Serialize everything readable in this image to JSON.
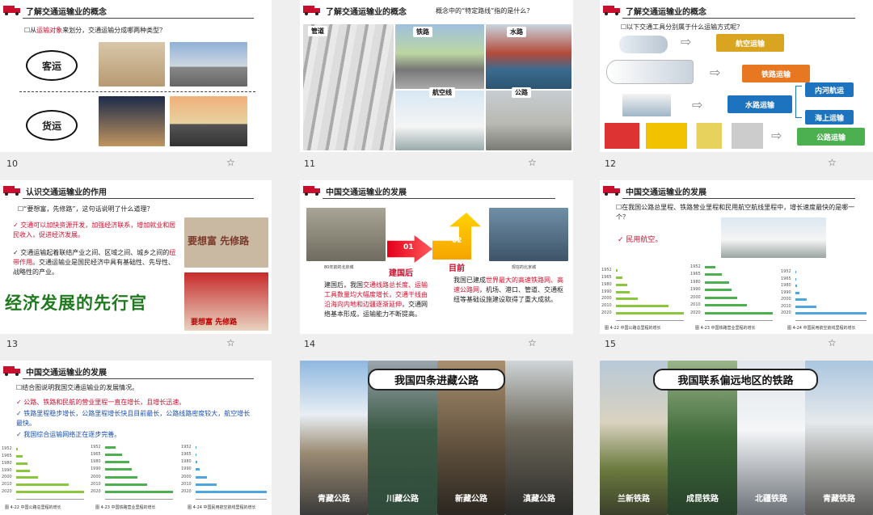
{
  "slides": [
    {
      "num": "10",
      "title": "了解交通运输业的概念",
      "question": "从运输对象来划分，交通运输分成哪两种类型？",
      "keyword": "运输对象",
      "passenger": "客运",
      "freight": "货运"
    },
    {
      "num": "11",
      "title": "了解交通运输业的概念",
      "note": "概念中的“特定路线”指的是什么？",
      "pipeline": "管道",
      "railway": "铁路",
      "waterway": "水路",
      "airline": "航空线",
      "highway": "公路"
    },
    {
      "num": "12",
      "title": "了解交通运输业的概念",
      "question": "以下交通工具分别属于什么运输方式呢？",
      "air": "航空运输",
      "rail": "铁路运输",
      "water": "水路运输",
      "inland": "内河航运",
      "sea": "海上运输",
      "road": "公路运输"
    },
    {
      "num": "13",
      "title": "认识交通运输业的作用",
      "question": "“要想富，先修路”，这句话说明了什么道理？",
      "point1": "交通可以加快资源开发，加强经济联系，增加就业和居民收入，促进经济发展。",
      "point2a": "交通运输起着联结产业之间、区域之间、城乡之间的",
      "point2b": "纽带作用",
      "point2c": "。交通运输业是国民经济中具有基础性、先导性、战略性的产业。",
      "sign_text": "要想富 先修路",
      "poster_text": "要想富 先修路",
      "slogan": "经济发展的先行官"
    },
    {
      "num": "14",
      "title": "中国交通运输业的发展",
      "photo1_caption": "80年前的北京城",
      "photo2_caption": "现在的北京城",
      "step1": "01",
      "step2": "02",
      "label1": "建国后",
      "label2": "目前",
      "para1a": "建国后，我国",
      "para1b": "交通线路总长度、运输工具数量均大幅度增长，交通干线由沿海向内地和边疆逐渐延伸",
      "para1c": "，交通网络基本形成，运输能力不断提高。",
      "para2a": "我国已建成",
      "para2b": "世界最大的高速铁路网、高速公路网",
      "para2c": "，机场、港口、管道、交通枢纽等基础设施建设取得了重大成就。"
    },
    {
      "num": "15",
      "title": "中国交通运输业的发展",
      "question": "在我国公路总里程、铁路营业里程和民用航空航线里程中，增长速度最快的是哪一个？",
      "answer": "✓ 民用航空。",
      "cap1": "图 4-22  中国公路总里程的增长",
      "cap2": "图 4-23  中国铁路营业里程的增长",
      "cap3": "图 4-24  中国民用航空航线里程的增长"
    },
    {
      "num": "",
      "title": "中国交通运输业的发展",
      "question": "结合图说明我国交通运输业的发展情况。",
      "p1": "公路、铁路和民航的营业里程一直在增长，且增长迅速。",
      "p2": "铁路里程稳步增长，公路里程增长快且目前最长，公路线路密度较大，航空增长最快。",
      "p3": "我国综合运输网络正在逐步完善。",
      "cap1": "图 4-22  中国公路总里程的增长",
      "cap2": "图 4-23  中国铁路营业里程的增长",
      "cap3": "图 4-24  中国民用航空航线里程的增长"
    },
    {
      "banner": "我国四条进藏公路",
      "roads": [
        "青藏公路",
        "川藏公路",
        "新藏公路",
        "滇藏公路"
      ]
    },
    {
      "banner": "我国联系偏远地区的铁路",
      "rails": [
        "兰新铁路",
        "成昆铁路",
        "北疆铁路",
        "青藏铁路"
      ]
    }
  ],
  "chart_axis": {
    "years": [
      "1952",
      "1965",
      "1980",
      "1990",
      "2000",
      "2010",
      "2020"
    ]
  },
  "chart_data": [
    {
      "type": "bar",
      "title": "图 4-22  中国公路总里程的增长",
      "categories": [
        "1952",
        "1965",
        "1980",
        "1990",
        "2000",
        "2010",
        "2020"
      ],
      "values": [
        13,
        51,
        89,
        103,
        168,
        401,
        520
      ],
      "xlabel": "里程/万千米"
    },
    {
      "type": "bar",
      "title": "图 4-23  中国铁路营业里程的增长",
      "categories": [
        "1952",
        "1965",
        "1980",
        "1990",
        "2000",
        "2010",
        "2020"
      ],
      "values": [
        2.3,
        3.6,
        5.3,
        5.8,
        6.9,
        9.1,
        14.6
      ],
      "xlabel": "里程/万千米"
    },
    {
      "type": "bar",
      "title": "图 4-24  中国民用航空航线里程的增长",
      "categories": [
        "1952",
        "1965",
        "1980",
        "1990",
        "2000",
        "2010",
        "2020"
      ],
      "values": [
        1,
        4,
        20,
        50,
        150,
        276,
        940
      ],
      "xlabel": "里程/万千米"
    }
  ],
  "colors": {
    "accent_red": "#c8102e",
    "blue": "#1a4fb5",
    "orange": "#e87722",
    "green": "#4caf50",
    "gold": "#d9a520"
  }
}
